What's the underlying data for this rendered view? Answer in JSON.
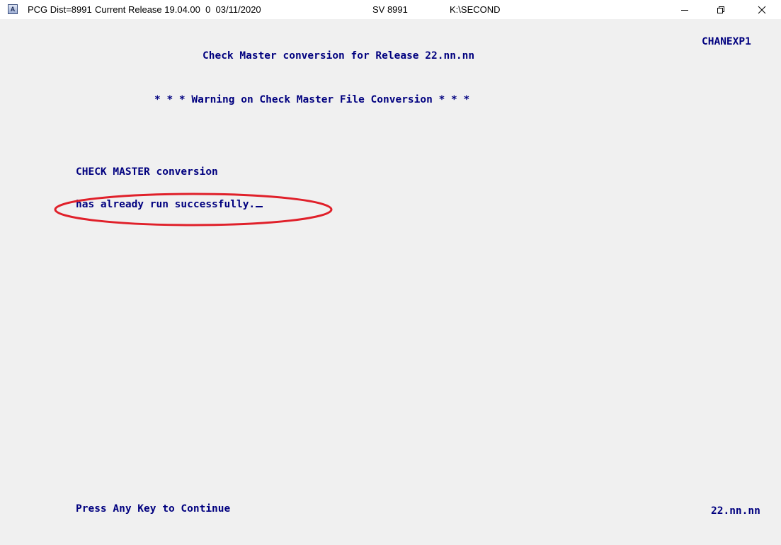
{
  "titlebar": {
    "icon_glyph": "A",
    "dist": "PCG Dist=8991",
    "release": "Current Release 19.04.00  0  03/11/2020",
    "sv": "SV 8991",
    "path": "K:\\SECOND",
    "icons": {
      "minimize": "minimize-icon",
      "restore": "restore-icon",
      "close": "close-icon"
    }
  },
  "screen": {
    "program_id": "CHANEXP1",
    "title": "Check Master conversion for Release 22.nn.nn",
    "warning": "* * * Warning on Check Master File Conversion * * *",
    "message_line1": "CHECK MASTER conversion",
    "message_line2": "has already run successfully.",
    "prompt": "Press Any Key to Continue",
    "version": "22.nn.nn"
  },
  "colors": {
    "text": "#00007f",
    "background": "#f0f0f0",
    "annotation": "#e0202a"
  }
}
